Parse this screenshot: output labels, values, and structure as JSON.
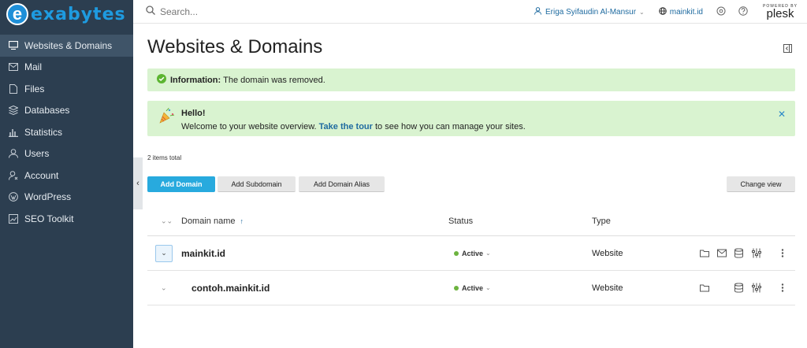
{
  "brand": {
    "name": "exabytes"
  },
  "sidebar": {
    "items": [
      {
        "label": "Websites & Domains",
        "icon": "monitor-icon",
        "active": true
      },
      {
        "label": "Mail",
        "icon": "mail-icon"
      },
      {
        "label": "Files",
        "icon": "file-icon"
      },
      {
        "label": "Databases",
        "icon": "database-icon"
      },
      {
        "label": "Statistics",
        "icon": "bar-chart-icon"
      },
      {
        "label": "Users",
        "icon": "user-icon"
      },
      {
        "label": "Account",
        "icon": "account-icon"
      },
      {
        "label": "WordPress",
        "icon": "wordpress-icon"
      },
      {
        "label": "SEO Toolkit",
        "icon": "seo-chart-icon"
      }
    ]
  },
  "topbar": {
    "search_placeholder": "Search...",
    "user_name": "Eriga Syifaudin Al-Mansur",
    "domain": "mainkit.id",
    "plesk_powered": "POWERED BY",
    "plesk_name": "plesk"
  },
  "page": {
    "title": "Websites & Domains",
    "info_label": "Information:",
    "info_text": "The domain was removed.",
    "hello_title": "Hello!",
    "hello_text_before": "Welcome to your website overview.",
    "hello_link": "Take the tour",
    "hello_text_after": "to see how you can manage your sites.",
    "items_total": "2 items total"
  },
  "toolbar": {
    "add_domain": "Add Domain",
    "add_subdomain": "Add Subdomain",
    "add_alias": "Add Domain Alias",
    "change_view": "Change view"
  },
  "table": {
    "headers": {
      "name": "Domain name",
      "sort_arrow": "↑",
      "status": "Status",
      "type": "Type"
    },
    "rows": [
      {
        "name": "mainkit.id",
        "status": "Active",
        "type": "Website"
      },
      {
        "name": "contoh.mainkit.id",
        "status": "Active",
        "type": "Website"
      }
    ]
  },
  "colors": {
    "sidebar": "#2c3e50",
    "accent": "#28aade",
    "success_bg": "#d9f3d0",
    "active_dot": "#6cb33f"
  }
}
